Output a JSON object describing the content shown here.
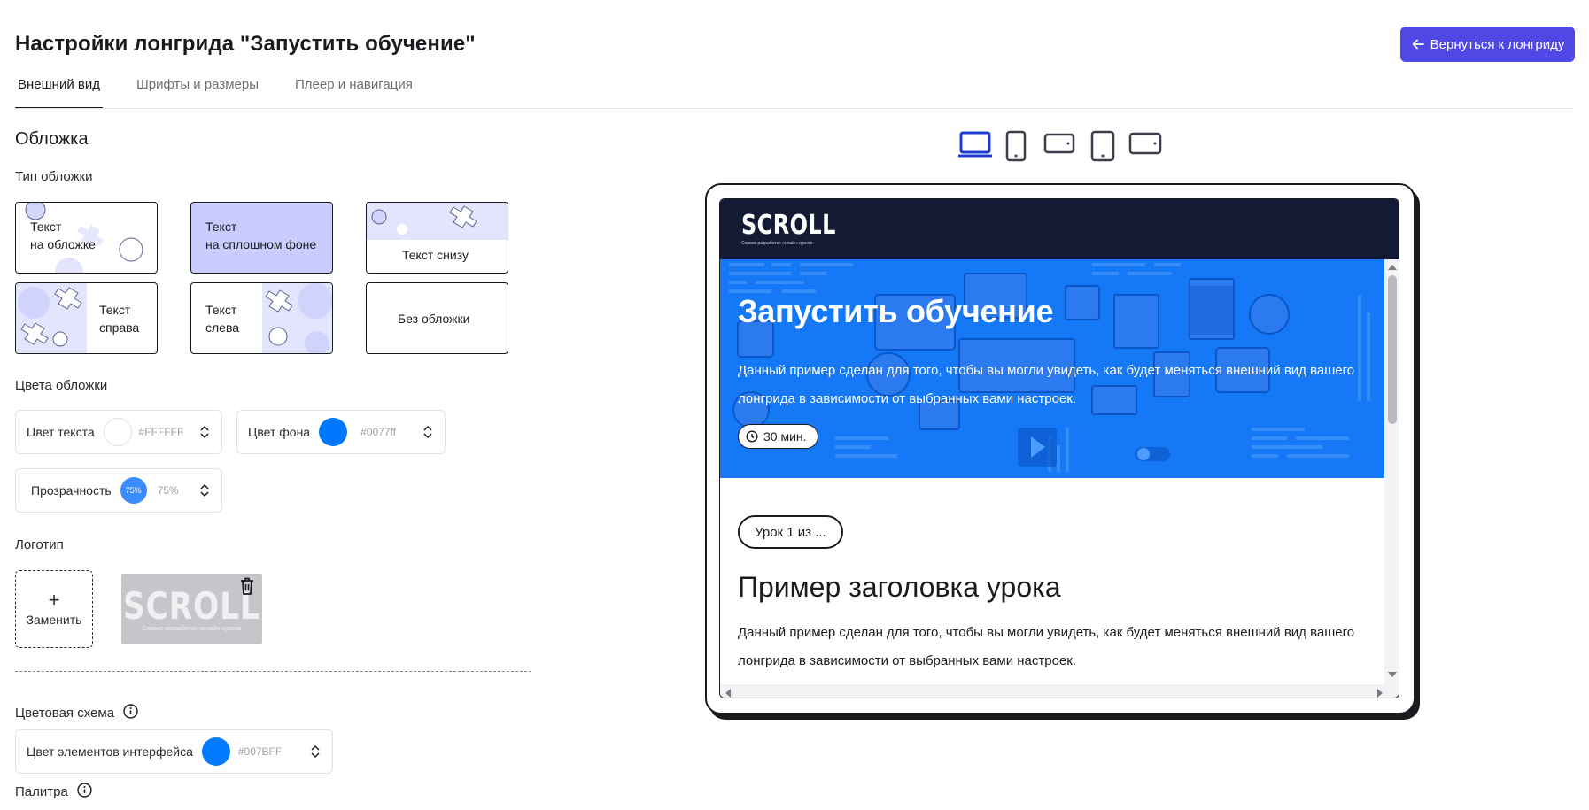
{
  "page": {
    "title": "Настройки лонгрида \"Запустить обучение\"",
    "back_button": "Вернуться к лонгриду"
  },
  "tabs": [
    {
      "label": "Внешний вид",
      "active": true
    },
    {
      "label": "Шрифты и размеры",
      "active": false
    },
    {
      "label": "Плеер и навигация",
      "active": false
    }
  ],
  "cover": {
    "section_title": "Обложка",
    "type_label": "Тип обложки",
    "types": [
      {
        "line1": "Текст",
        "line2": "на обложке"
      },
      {
        "line1": "Текст",
        "line2": "на сплошном фоне",
        "selected": true
      },
      {
        "line1": "Текст снизу",
        "line2": ""
      },
      {
        "line1": "Текст",
        "line2": "справа"
      },
      {
        "line1": "Текст",
        "line2": "слева"
      },
      {
        "line1": "Без обложки",
        "line2": ""
      }
    ],
    "colors_label": "Цвета обложки",
    "text_color": {
      "label": "Цвет текста",
      "value": "#FFFFFF"
    },
    "bg_color": {
      "label": "Цвет фона",
      "value": "#0077ff"
    },
    "opacity": {
      "label": "Прозрачность",
      "badge": "75%",
      "value": "75%"
    }
  },
  "logo": {
    "label": "Логотип",
    "replace_plus": "+",
    "replace_label": "Заменить",
    "thumb_text": "SCROLL",
    "thumb_sub": "Сервис разработки онлайн-курсов"
  },
  "scheme": {
    "label": "Цветовая схема",
    "ui_color": {
      "label": "Цвет элементов интерфейса",
      "value": "#007BFF"
    },
    "palette_label": "Палитра"
  },
  "devices": [
    "laptop-icon",
    "tablet-portrait-icon",
    "tablet-landscape-icon",
    "tablet-portrait-icon",
    "tablet-landscape-icon"
  ],
  "preview": {
    "brand": "SCROLL",
    "brand_sub": "Сервис разработки онлайн-курсов",
    "hero_title": "Запустить обучение",
    "hero_desc": "Данный пример сделан для того, чтобы вы могли увидеть, как будет меняться внешний вид вашего лонгрида в зависимости от выбранных вами настроек.",
    "duration": "30 мин.",
    "lesson_badge": "Урок 1 из ...",
    "lesson_title": "Пример заголовка урока",
    "lesson_text": "Данный пример сделан для того, чтобы вы могли увидеть, как будет меняться внешний вид вашего лонгрида в зависимости от выбранных вами настроек."
  },
  "colors": {
    "accent": "#5048e5",
    "selected_card": "#c8cdfd",
    "hero_bg": "#0077ff",
    "header_bg": "#131a33"
  }
}
